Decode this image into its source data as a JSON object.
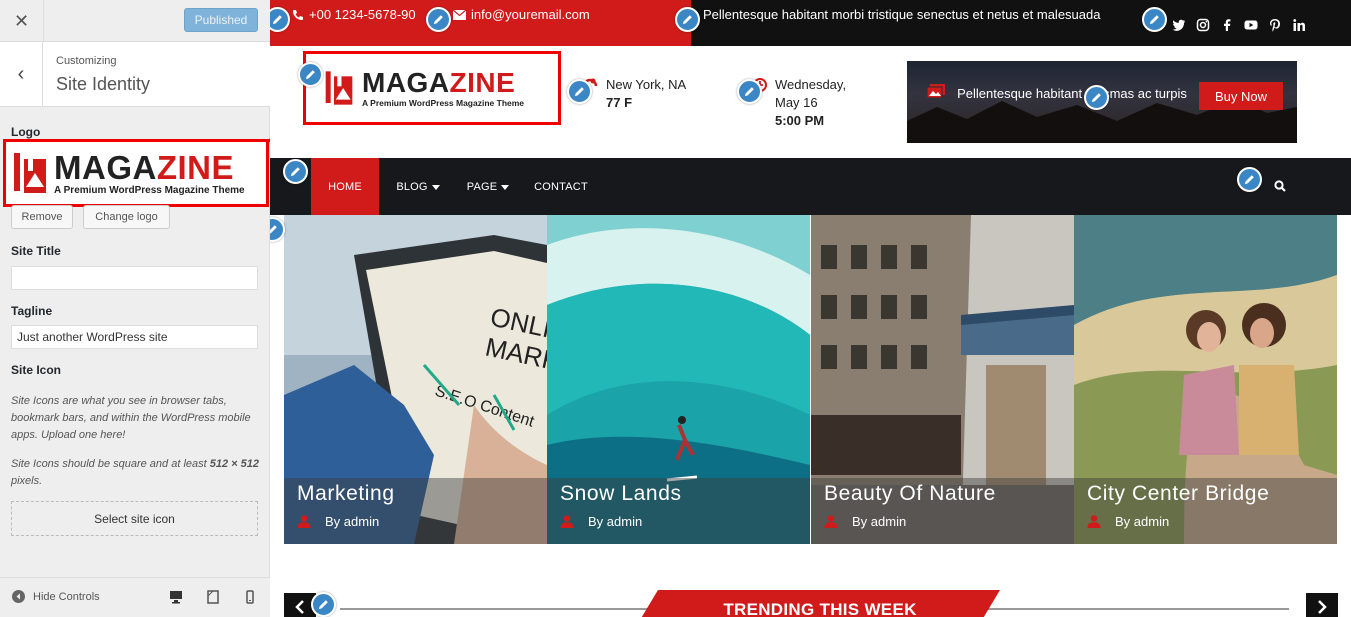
{
  "customizer": {
    "publish_label": "Published",
    "breadcrumb": "Customizing",
    "section_title": "Site Identity",
    "logo_label": "Logo",
    "remove_label": "Remove",
    "change_logo_label": "Change logo",
    "site_title_label": "Site Title",
    "site_title_value": "",
    "tagline_label": "Tagline",
    "tagline_value": "Just another WordPress site",
    "site_icon_label": "Site Icon",
    "site_icon_desc1": "Site Icons are what you see in browser tabs, bookmark bars, and within the WordPress mobile apps. Upload one here!",
    "site_icon_desc2_a": "Site Icons should be square and at least ",
    "site_icon_desc2_b": "512 × 512",
    "site_icon_desc2_c": " pixels.",
    "select_icon_label": "Select site icon",
    "hide_controls_label": "Hide Controls"
  },
  "logo": {
    "brand_a": "MAGA",
    "brand_b": "ZINE",
    "tagline": "A Premium WordPress Magazine Theme"
  },
  "topbar": {
    "phone": "+00 1234-5678-90",
    "email": "info@youremail.com",
    "ticker": "Pellentesque habitant morbi tristique senectus et netus et malesuada"
  },
  "weather": {
    "location": "New York, NA",
    "temp": "77 F",
    "day": "Wednesday,",
    "date": "May 16",
    "time": "5:00 PM"
  },
  "ad": {
    "text": "Pellentesque habitant elesmas ac turpis",
    "button": "Buy Now"
  },
  "nav": {
    "home": "HOME",
    "blog": "BLOG",
    "page": "PAGE",
    "contact": "CONTACT"
  },
  "slides": [
    {
      "title": "Marketing",
      "author": "By admin"
    },
    {
      "title": "Snow Lands",
      "author": "By admin"
    },
    {
      "title": "Beauty Of Nature",
      "author": "By admin"
    },
    {
      "title": "City Center Bridge",
      "author": "By admin"
    }
  ],
  "trending": {
    "title": "TRENDING THIS WEEK"
  },
  "colors": {
    "accent_red": "#d11b1b",
    "nav_dark": "#16181c",
    "edit_blue": "#3b87c5"
  }
}
